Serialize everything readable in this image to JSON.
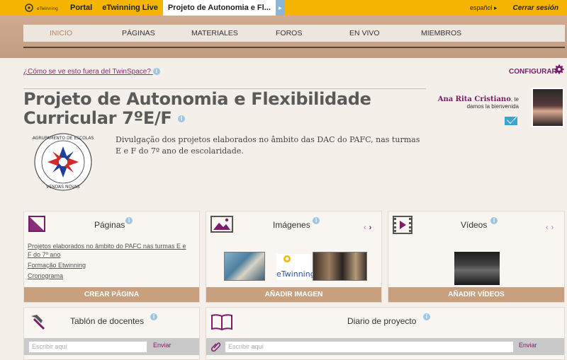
{
  "topbar": {
    "logo_text": "eTwinning",
    "tabs": [
      {
        "label": "Portal"
      },
      {
        "label": "eTwinning Live"
      },
      {
        "label": "Projeto de Autonomia e Fl..."
      }
    ],
    "language": "español ▸",
    "logout": "Cerrar sesión"
  },
  "nav": {
    "items": [
      {
        "label": "INICIO"
      },
      {
        "label": "PÁGINAS"
      },
      {
        "label": "MATERIALES"
      },
      {
        "label": "FOROS"
      },
      {
        "label": "EN VIVO"
      },
      {
        "label": "MIEMBROS"
      }
    ]
  },
  "header": {
    "question_link": "¿Cómo se ve esto fuera del TwinSpace?",
    "configure": "CONFIGURAR",
    "title": "Projeto de Autonomia e Flexibilidade Curricular 7ºE/F",
    "description": "Divulgação dos projetos elaborados no âmbito das DAC do PAFC, nas turmas E e F do 7º ano de escolaridade.",
    "welcome_name": "Ana Rita Cristiano",
    "welcome_suffix": ", te",
    "welcome_line2": "damos la bienvenida",
    "emblem_text_top": "AGRUPAMENTO DE ESCOLAS",
    "emblem_text_bottom": "VENDAS NOVAS"
  },
  "panels": {
    "pages": {
      "title": "Páginas",
      "links": [
        "Projetos elaborados no âmbito do PAFC nas turmas E e F do 7º ano",
        "Formação Etwinning",
        "Cronograma"
      ],
      "button": "CREAR PÁGINA"
    },
    "images": {
      "title": "Imágenes",
      "button": "AÑADIR IMAGEN",
      "logo_text": "eTwinning"
    },
    "videos": {
      "title": "Vídeos",
      "button": "AÑADIR VÍDEOS"
    },
    "board": {
      "title": "Tablón de docentes",
      "placeholder": "Escribir aquí",
      "send": "Enviar"
    },
    "diary": {
      "title": "Diario de proyecto",
      "placeholder": "Escribir aquí",
      "send": "Enviar"
    }
  },
  "colors": {
    "topbar": "#f4b400",
    "accent_purple": "#7a1b6b",
    "button_tan": "#c9a07d",
    "info_blue": "#9ec6e3"
  }
}
